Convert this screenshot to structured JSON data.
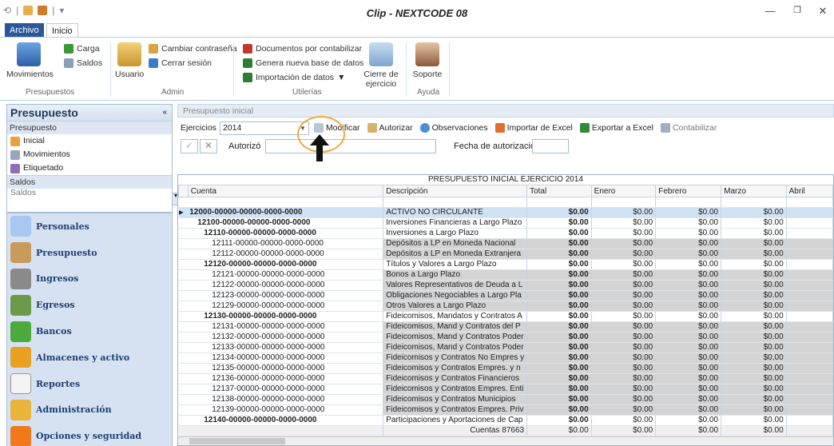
{
  "window": {
    "title": "Clip - NEXTCODE 08",
    "qat_sep": "|"
  },
  "tabs": {
    "archivo": "Archivo",
    "inicio": "Inicio"
  },
  "ribbon": {
    "movimientos": "Movimientos",
    "carga": "Carga",
    "saldos": "Saldos",
    "group_presupuestos": "Presupuestos",
    "usuario": "Usuario",
    "cambiar": "Cambiar contraseña",
    "cerrar": "Cerrar sesión",
    "group_admin": "Admin",
    "docs": "Documentos por contabilizar",
    "genera": "Genera nueva base de datos",
    "importacion": "Importación de datos",
    "cierre1": "Cierre de",
    "cierre2": "ejercicio",
    "group_utilerias": "Utilerías",
    "soporte": "Soporte",
    "group_ayuda": "Ayuda"
  },
  "left": {
    "title": "Presupuesto",
    "collapse": "«",
    "section1": "Presupuesto",
    "items": [
      "Inicial",
      "Movimientos",
      "Etiquetado"
    ],
    "section2": "Saldos",
    "cut_item": "Saldos",
    "nav": [
      "Personales",
      "Presupuesto",
      "Ingresos",
      "Egresos",
      "Bancos",
      "Almacenes y activo",
      "Reportes",
      "Administración",
      "Opciones y seguridad"
    ]
  },
  "main": {
    "header": "Presupuesto inicial",
    "ejercicios_label": "Ejercicios",
    "ejercicio_value": "2014",
    "modificar": "Modificar",
    "autorizar": "Autorizar",
    "observaciones": "Observaciones",
    "importar": "Importar de Excel",
    "exportar": "Exportar a Excel",
    "contabilizar": "Contabilizar",
    "autorizo": "Autorizó",
    "fecha": "Fecha de autorización"
  },
  "grid": {
    "title": "PRESUPUESTO INICIAL EJERCICIO 2014",
    "columns": [
      "Cuenta",
      "Descripción",
      "Total",
      "Enero",
      "Febrero",
      "Marzo",
      "Abril"
    ],
    "rows": [
      {
        "cuenta": "12000-00000-00000-0000-0000",
        "desc": "ACTIVO NO CIRCULANTE",
        "total": "$0.00",
        "enero": "$0.00",
        "febrero": "$0.00",
        "marzo": "$0.00",
        "level": 0,
        "hl": true
      },
      {
        "cuenta": "12100-00000-00000-0000-0000",
        "desc": "Inversiones Financieras a Largo Plazo",
        "total": "$0.00",
        "enero": "$0.00",
        "febrero": "$0.00",
        "marzo": "$0.00",
        "level": 1
      },
      {
        "cuenta": "12110-00000-00000-0000-0000",
        "desc": "Inversiones a Largo Plazo",
        "total": "$0.00",
        "enero": "$0.00",
        "febrero": "$0.00",
        "marzo": "$0.00",
        "level": 2
      },
      {
        "cuenta": "12111-00000-00000-0000-0000",
        "desc": "Depósitos a LP en Moneda Nacional",
        "total": "$0.00",
        "enero": "$0.00",
        "febrero": "$0.00",
        "marzo": "$0.00",
        "level": 3
      },
      {
        "cuenta": "12112-00000-00000-0000-0000",
        "desc": "Depósitos a LP en Moneda Extranjera",
        "total": "$0.00",
        "enero": "$0.00",
        "febrero": "$0.00",
        "marzo": "$0.00",
        "level": 3
      },
      {
        "cuenta": "12120-00000-00000-0000-0000",
        "desc": "Títulos y Valores a Largo Plazo",
        "total": "$0.00",
        "enero": "$0.00",
        "febrero": "$0.00",
        "marzo": "$0.00",
        "level": 2
      },
      {
        "cuenta": "12121-00000-00000-0000-0000",
        "desc": "Bonos a Largo Plazo",
        "total": "$0.00",
        "enero": "$0.00",
        "febrero": "$0.00",
        "marzo": "$0.00",
        "level": 3
      },
      {
        "cuenta": "12122-00000-00000-0000-0000",
        "desc": "Valores Representativos de Deuda a L",
        "total": "$0.00",
        "enero": "$0.00",
        "febrero": "$0.00",
        "marzo": "$0.00",
        "level": 3
      },
      {
        "cuenta": "12123-00000-00000-0000-0000",
        "desc": "Obligaciones Negociables a Largo Pla",
        "total": "$0.00",
        "enero": "$0.00",
        "febrero": "$0.00",
        "marzo": "$0.00",
        "level": 3
      },
      {
        "cuenta": "12129-00000-00000-0000-0000",
        "desc": "Otros Valores a Largo Plazo",
        "total": "$0.00",
        "enero": "$0.00",
        "febrero": "$0.00",
        "marzo": "$0.00",
        "level": 3
      },
      {
        "cuenta": "12130-00000-00000-0000-0000",
        "desc": "Fideicomisos, Mandatos y Contratos A",
        "total": "$0.00",
        "enero": "$0.00",
        "febrero": "$0.00",
        "marzo": "$0.00",
        "level": 2
      },
      {
        "cuenta": "12131-00000-00000-0000-0000",
        "desc": "Fideicomisos, Mand y Contratos del P",
        "total": "$0.00",
        "enero": "$0.00",
        "febrero": "$0.00",
        "marzo": "$0.00",
        "level": 3
      },
      {
        "cuenta": "12132-00000-00000-0000-0000",
        "desc": "Fideicomisos, Mand y Contratos Poder",
        "total": "$0.00",
        "enero": "$0.00",
        "febrero": "$0.00",
        "marzo": "$0.00",
        "level": 3
      },
      {
        "cuenta": "12133-00000-00000-0000-0000",
        "desc": "Fideicomisos, Mand y Contratos Poder",
        "total": "$0.00",
        "enero": "$0.00",
        "febrero": "$0.00",
        "marzo": "$0.00",
        "level": 3
      },
      {
        "cuenta": "12134-00000-00000-0000-0000",
        "desc": "Fideicomisos y Contratos No Empres y",
        "total": "$0.00",
        "enero": "$0.00",
        "febrero": "$0.00",
        "marzo": "$0.00",
        "level": 3
      },
      {
        "cuenta": "12135-00000-00000-0000-0000",
        "desc": "Fideicomisos y Contratos Empres. y n",
        "total": "$0.00",
        "enero": "$0.00",
        "febrero": "$0.00",
        "marzo": "$0.00",
        "level": 3
      },
      {
        "cuenta": "12136-00000-00000-0000-0000",
        "desc": "Fideicomisos y Contratos Financieros",
        "total": "$0.00",
        "enero": "$0.00",
        "febrero": "$0.00",
        "marzo": "$0.00",
        "level": 3
      },
      {
        "cuenta": "12137-00000-00000-0000-0000",
        "desc": "Fideicomisos y Contratos Empres. Enti",
        "total": "$0.00",
        "enero": "$0.00",
        "febrero": "$0.00",
        "marzo": "$0.00",
        "level": 3
      },
      {
        "cuenta": "12138-00000-00000-0000-0000",
        "desc": "Fideicomisos y Contratos Municipios",
        "total": "$0.00",
        "enero": "$0.00",
        "febrero": "$0.00",
        "marzo": "$0.00",
        "level": 3
      },
      {
        "cuenta": "12139-00000-00000-0000-0000",
        "desc": "Fideicomisos y Contratos Empres. Priv",
        "total": "$0.00",
        "enero": "$0.00",
        "febrero": "$0.00",
        "marzo": "$0.00",
        "level": 3
      },
      {
        "cuenta": "12140-00000-00000-0000-0000",
        "desc": "Participaciones y Aportaciones de Cap",
        "total": "$0.00",
        "enero": "$0.00",
        "febrero": "$0.00",
        "marzo": "$0.00",
        "level": 2
      }
    ],
    "footer": {
      "cuentas": "Cuentas 87663",
      "total": "$0.00",
      "enero": "$0.00",
      "febrero": "$0.00",
      "marzo": "$0.00"
    }
  },
  "colors": {
    "accent": "#2b579a",
    "callout": "#f2a93b",
    "highlight": "#cfe3f5"
  }
}
